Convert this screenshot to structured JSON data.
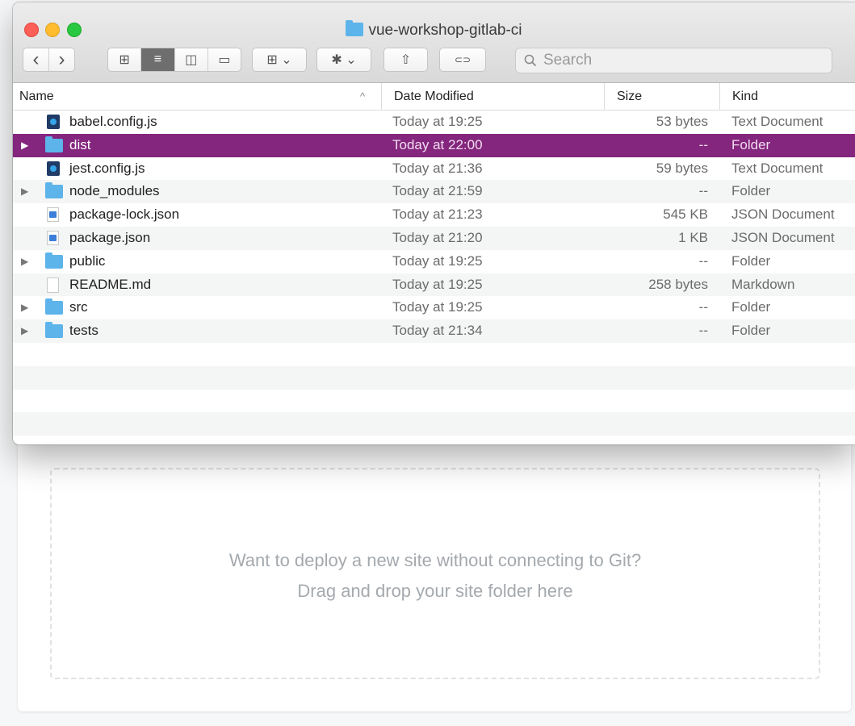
{
  "window": {
    "title": "vue-workshop-gitlab-ci"
  },
  "toolbar": {
    "back_label": "‹",
    "forward_label": "›",
    "view_icon_label": "⊞",
    "view_list_label": "≡",
    "view_columns_label": "◫",
    "view_gallery_label": "▭",
    "group_label": "⊞ ⌄",
    "action_label": "✱ ⌄",
    "share_label": "⇧",
    "tag_label": "⊂⊃"
  },
  "search": {
    "placeholder": "Search",
    "value": ""
  },
  "columns": {
    "name": "Name",
    "date_modified": "Date Modified",
    "size": "Size",
    "kind": "Kind"
  },
  "files": [
    {
      "name": "babel.config.js",
      "date": "Today at 19:25",
      "size": "53 bytes",
      "kind": "Text Document",
      "type": "js",
      "expandable": false,
      "selected": false
    },
    {
      "name": "dist",
      "date": "Today at 22:00",
      "size": "--",
      "kind": "Folder",
      "type": "folder",
      "expandable": true,
      "selected": true
    },
    {
      "name": "jest.config.js",
      "date": "Today at 21:36",
      "size": "59 bytes",
      "kind": "Text Document",
      "type": "js",
      "expandable": false,
      "selected": false
    },
    {
      "name": "node_modules",
      "date": "Today at 21:59",
      "size": "--",
      "kind": "Folder",
      "type": "folder",
      "expandable": true,
      "selected": false
    },
    {
      "name": "package-lock.json",
      "date": "Today at 21:23",
      "size": "545 KB",
      "kind": "JSON Document",
      "type": "json",
      "expandable": false,
      "selected": false
    },
    {
      "name": "package.json",
      "date": "Today at 21:20",
      "size": "1 KB",
      "kind": "JSON Document",
      "type": "json",
      "expandable": false,
      "selected": false
    },
    {
      "name": "public",
      "date": "Today at 19:25",
      "size": "--",
      "kind": "Folder",
      "type": "folder",
      "expandable": true,
      "selected": false
    },
    {
      "name": "README.md",
      "date": "Today at 19:25",
      "size": "258 bytes",
      "kind": "Markdown",
      "type": "doc",
      "expandable": false,
      "selected": false
    },
    {
      "name": "src",
      "date": "Today at 19:25",
      "size": "--",
      "kind": "Folder",
      "type": "folder",
      "expandable": true,
      "selected": false
    },
    {
      "name": "tests",
      "date": "Today at 21:34",
      "size": "--",
      "kind": "Folder",
      "type": "folder",
      "expandable": true,
      "selected": false
    }
  ],
  "dropzone": {
    "line1": "Want to deploy a new site without connecting to Git?",
    "line2": "Drag and drop your site folder here"
  },
  "colors": {
    "selection": "#84267e",
    "folder": "#5db4ea"
  }
}
